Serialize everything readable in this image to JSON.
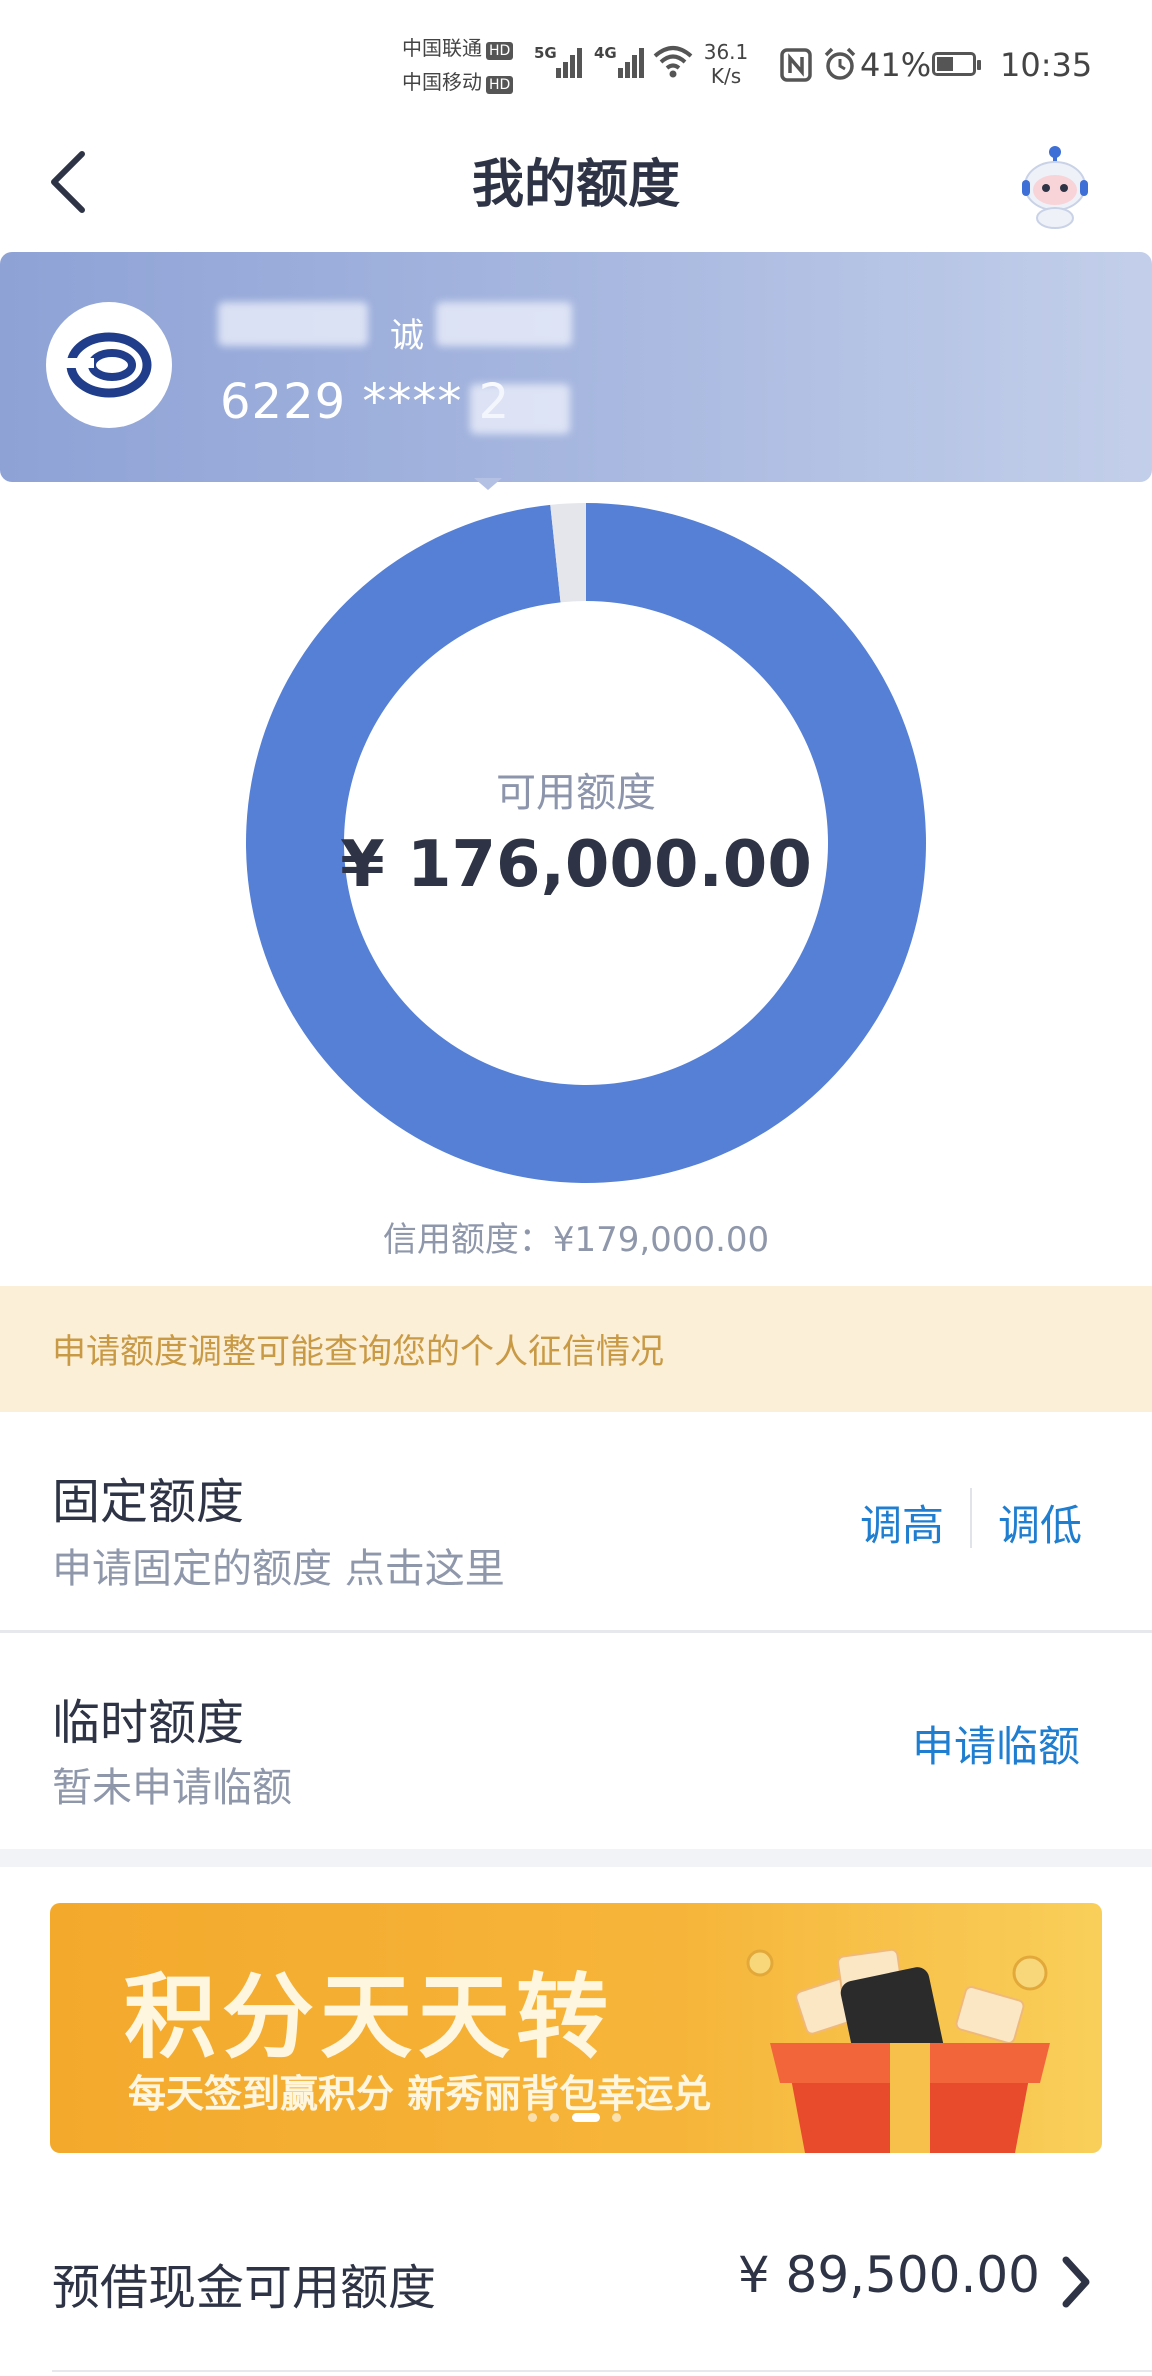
{
  "status_bar": {
    "carrier1": "中国联通",
    "carrier2": "中国移动",
    "hd": "HD",
    "net1": "5G",
    "net2": "4G",
    "speed_value": "36.1",
    "speed_unit": "K/s",
    "battery": "41%",
    "time": "10:35",
    "icons": [
      "signal-icon",
      "wifi-icon",
      "nfc-icon",
      "alarm-icon",
      "battery-icon"
    ]
  },
  "nav": {
    "back_icon": "chevron-left-icon",
    "title": "我的额度",
    "assistant_icon": "robot-assistant-icon"
  },
  "card": {
    "holder_name_visible": "诚",
    "number": "6229 **** 2",
    "logo_icon": "bank-logo-icon"
  },
  "chart_data": {
    "type": "pie",
    "style": "donut",
    "values": [
      176000,
      3000
    ],
    "colors": [
      "#5580d6",
      "#e4e6ec"
    ]
  },
  "credit": {
    "available_label": "可用额度",
    "available_amount": "¥ 176,000.00",
    "limit_text": "信用额度：¥179,000.00"
  },
  "notice": {
    "text": "申请额度调整可能查询您的个人征信情况"
  },
  "fixed_limit": {
    "title": "固定额度",
    "subtitle": "申请固定的额度 点击这里",
    "raise": "调高",
    "lower": "调低"
  },
  "temp_limit": {
    "title": "临时额度",
    "subtitle": "暂未申请临额",
    "apply": "申请临额"
  },
  "promo": {
    "title": "积分天天转",
    "subtitle": "每天签到赢积分 新秀丽背包幸运兑",
    "page_count": 4,
    "active_page": 2
  },
  "cash": {
    "label": "预借现金可用额度",
    "amount": "¥ 89,500.00"
  },
  "colors": {
    "accent": "#5580d6",
    "link": "#1f7ed0",
    "notice_bg": "#fcefd7",
    "notice_text": "#c99a45"
  }
}
